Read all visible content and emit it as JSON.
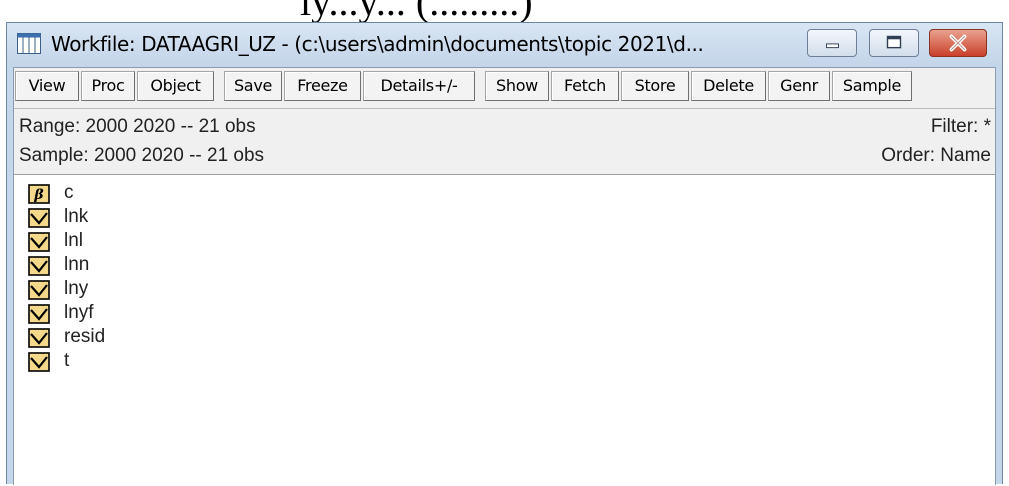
{
  "background_text": "ly...y... (.........)",
  "window": {
    "title": "Workfile: DATAAGRI_UZ - (c:\\users\\admin\\documents\\topic 2021\\d..."
  },
  "toolbar": {
    "buttons": [
      "View",
      "Proc",
      "Object",
      "Save",
      "Freeze",
      "Details+/-",
      "Show",
      "Fetch",
      "Store",
      "Delete",
      "Genr",
      "Sample"
    ]
  },
  "info": {
    "range": "Range:  2000 2020  --  21 obs",
    "sample": "Sample: 2000 2020  --  21 obs",
    "filter": "Filter: *",
    "order": "Order: Name"
  },
  "objects": [
    {
      "name": "c",
      "icon": "coefficient-beta-icon"
    },
    {
      "name": "lnk",
      "icon": "series-icon"
    },
    {
      "name": "lnl",
      "icon": "series-icon"
    },
    {
      "name": "lnn",
      "icon": "series-icon"
    },
    {
      "name": "lny",
      "icon": "series-icon"
    },
    {
      "name": "lnyf",
      "icon": "series-icon"
    },
    {
      "name": "resid",
      "icon": "series-icon"
    },
    {
      "name": "t",
      "icon": "series-icon"
    }
  ],
  "colors": {
    "icon_fill": "#f5d98b",
    "close_button": "#c9402a",
    "window_frame": "#c4d6ea"
  }
}
